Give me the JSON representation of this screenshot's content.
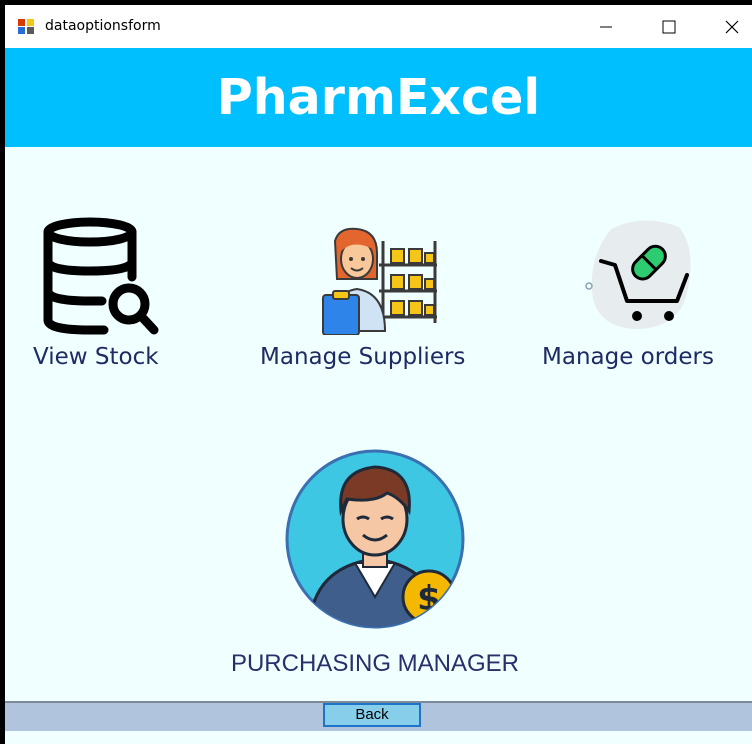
{
  "window": {
    "title": "dataoptionsform",
    "minimize_icon": "minimize-icon",
    "maximize_icon": "maximize-icon",
    "close_icon": "close-icon"
  },
  "header": {
    "title": "PharmExcel",
    "background": "#00bfff"
  },
  "menu": [
    {
      "label": "View Stock",
      "icon": "database-search-icon"
    },
    {
      "label": "Manage Suppliers",
      "icon": "supplier-warehouse-icon"
    },
    {
      "label": "Manage orders",
      "icon": "cart-pill-icon"
    }
  ],
  "role": {
    "label": "PURCHASING MANAGER",
    "icon": "purchasing-manager-avatar-icon"
  },
  "footer": {
    "back_label": "Back"
  },
  "colors": {
    "content_background": "#f0ffff",
    "label_text": "#1f2a63",
    "footer_bar": "#b0c4de",
    "back_button": "#87ceeb"
  }
}
